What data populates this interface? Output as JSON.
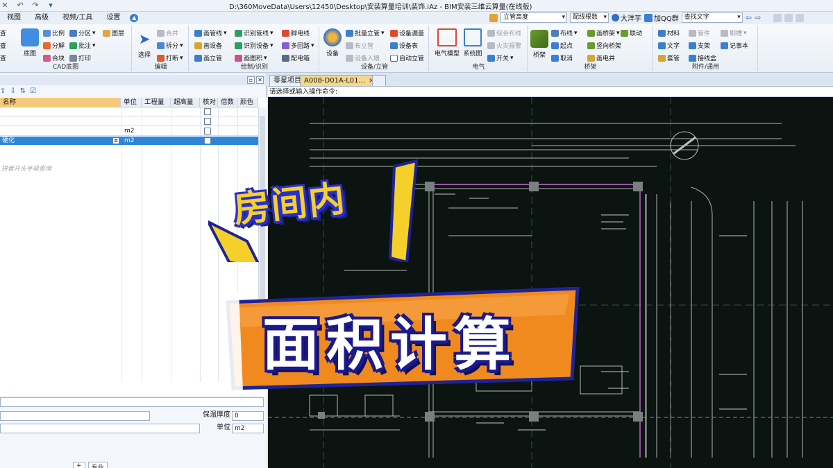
{
  "titlebar": {
    "title": "D:\\360MoveData\\Users\\12450\\Desktop\\安装算量培训\\装饰.iAz - BIM安装三维云算量(在线版)"
  },
  "menu": {
    "tabs": [
      "视图",
      "高级",
      "视频/工具",
      "设置"
    ],
    "combo_elevation": "立管高度",
    "combo_roots": "配线根数",
    "user_name": "大洋芋",
    "qq_label": "加QQ群",
    "search_placeholder": "查找文字"
  },
  "ribbon": {
    "cad_group": {
      "name": "CAD底图",
      "big_label": "底图",
      "items": [
        "比例",
        "分区",
        "图层",
        "分解",
        "批注",
        "合块",
        "打印"
      ],
      "left_items": [
        "查",
        "查",
        "查"
      ]
    },
    "edit_group": {
      "name": "编辑",
      "big_label": "选择",
      "items": [
        "合并",
        "拆分",
        "打断"
      ]
    },
    "draw_group": {
      "name": "绘制/识别",
      "items": [
        "画管线",
        "识别管线",
        "脚电线",
        "画设备",
        "识别设备",
        "多回路",
        "画立管",
        "画图积",
        "配电箱"
      ]
    },
    "device_group": {
      "name": "设备/立管",
      "big_label": "设备",
      "items": [
        "批量立管",
        "设备漏量",
        "布立管",
        "设备表",
        "设备入墙",
        "自动立管"
      ]
    },
    "elec_group": {
      "name": "电气",
      "big_labels": [
        "电气模型",
        "系统图"
      ],
      "items": [
        "综合布线",
        "火灾报警",
        "开关"
      ]
    },
    "bridge_group": {
      "name": "桥架",
      "big_label": "桥架",
      "items": [
        "布线",
        "画桥架",
        "联动",
        "起点",
        "竖向桥架",
        "取消",
        "画电井"
      ]
    },
    "attach_group": {
      "name": "附件/通用",
      "items": [
        "材料",
        "管件",
        "剔槽",
        "文字",
        "支架",
        "记事本",
        "套管",
        "接线盒"
      ]
    }
  },
  "leftpanel": {
    "columns": [
      "名称",
      "单位",
      "工程量",
      "超高量",
      "核对",
      "倍数",
      "颜色"
    ],
    "rows": [
      {
        "name": "",
        "unit": ""
      },
      {
        "name": "",
        "unit": ""
      },
      {
        "name": "",
        "unit": "m2"
      },
      {
        "name": "硬化",
        "unit": "m2"
      }
    ],
    "hint": "拼音开头字母查询",
    "props": {
      "insulation_label": "保温厚度",
      "insulation_value": "0",
      "unit_label": "单位",
      "unit_value": "m2",
      "bottom_tab": "专业"
    }
  },
  "document": {
    "tabs": [
      "零星项目",
      "A008-D01A-L01..."
    ],
    "command_prompt": "请选择或输入操作命令:"
  },
  "overlay": {
    "caption_top": "房间内",
    "caption_main": "面积计算"
  },
  "colors": {
    "canvas_bg": "#0b1410",
    "selected_row": "#2f86d8",
    "caption_yellow": "#f5d02a",
    "caption_orange": "#f08a1f",
    "caption_blue": "#2a2fd0"
  }
}
